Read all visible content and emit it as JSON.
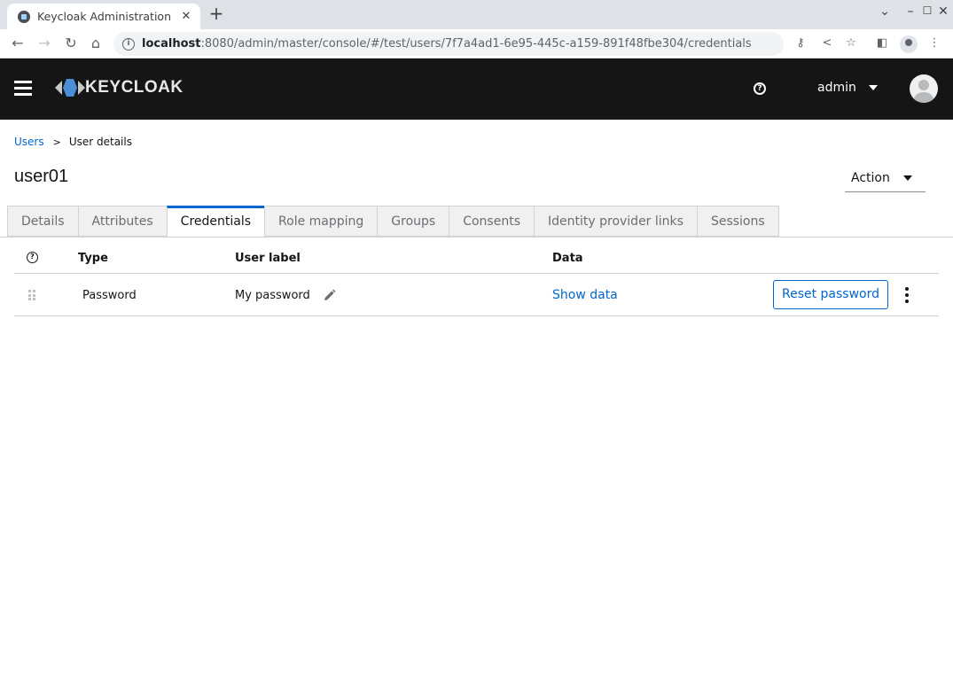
{
  "browser": {
    "tab_title": "Keycloak Administration C",
    "tab_close": "✕",
    "new_tab": "+",
    "url_host": "localhost",
    "url_rest": ":8080/admin/master/console/#/test/users/7f7a4ad1-6e95-445c-a159-891f48fbe304/credentials",
    "icons": [
      "back-icon",
      "forward-icon",
      "reload-icon",
      "home-icon",
      "info-icon",
      "key-icon",
      "share-icon",
      "star-icon",
      "sidebar-icon",
      "profile-icon",
      "menu-icon"
    ]
  },
  "masthead": {
    "logo_text": "KEYCLOAK",
    "user_name": "admin"
  },
  "breadcrumb": {
    "link": "Users",
    "current": "User details"
  },
  "page": {
    "title": "user01",
    "action_label": "Action"
  },
  "tabs": [
    {
      "label": "Details"
    },
    {
      "label": "Attributes"
    },
    {
      "label": "Credentials",
      "active": true
    },
    {
      "label": "Role mapping"
    },
    {
      "label": "Groups"
    },
    {
      "label": "Consents"
    },
    {
      "label": "Identity provider links"
    },
    {
      "label": "Sessions"
    }
  ],
  "table": {
    "headers": {
      "type": "Type",
      "user_label": "User label",
      "data": "Data"
    },
    "rows": [
      {
        "type": "Password",
        "user_label": "My password",
        "data_link": "Show data",
        "action": "Reset password"
      }
    ]
  },
  "colors": {
    "masthead": "#151515",
    "link": "#0066cc",
    "active_tab_border": "#0066cc"
  }
}
